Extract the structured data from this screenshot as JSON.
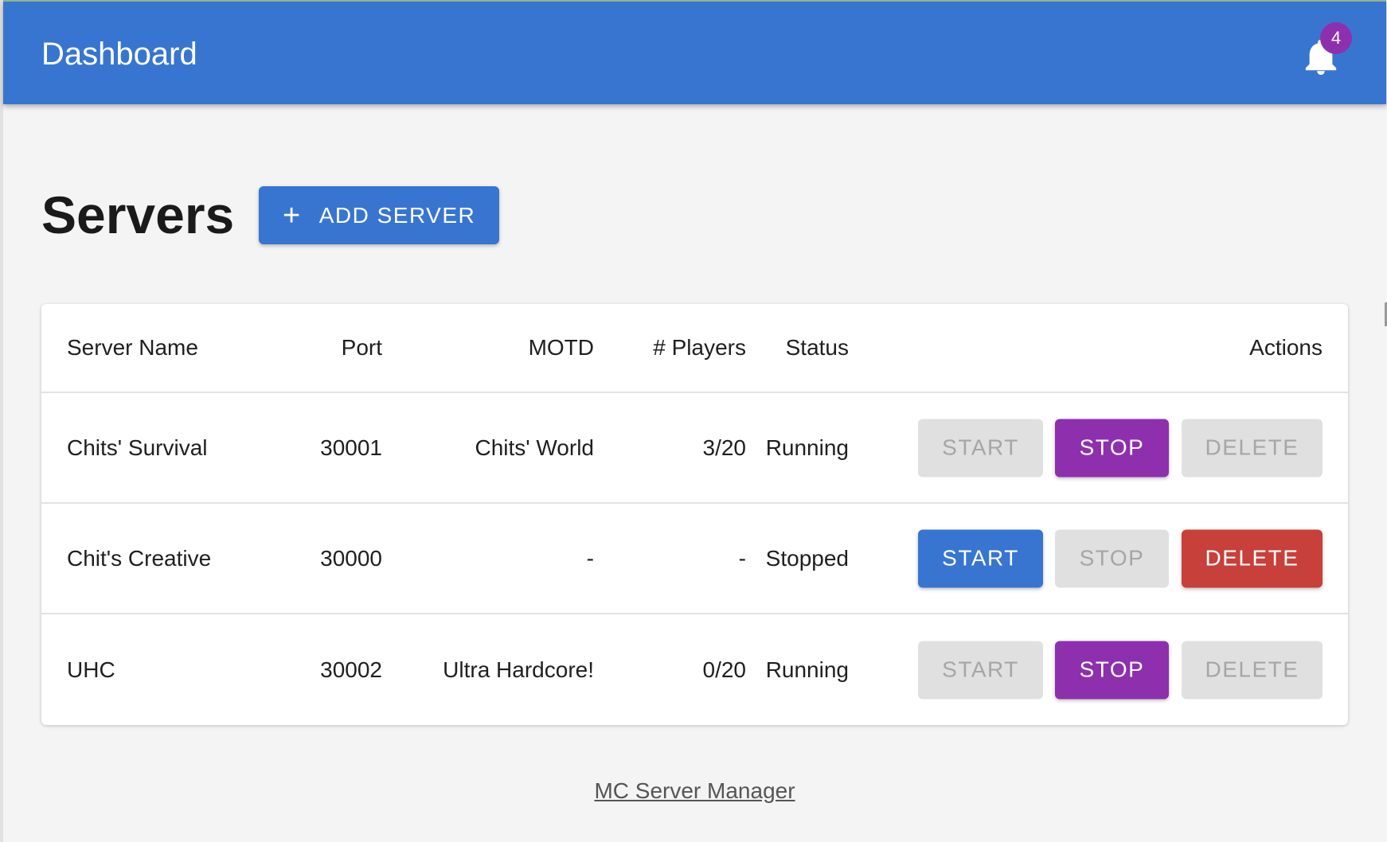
{
  "appbar": {
    "title": "Dashboard",
    "notifications": {
      "icon": "bell-icon",
      "count": "4"
    }
  },
  "page": {
    "title": "Servers",
    "add_button": {
      "icon": "plus-icon",
      "label": "ADD SERVER"
    }
  },
  "table": {
    "columns": {
      "name": "Server Name",
      "port": "Port",
      "motd": "MOTD",
      "players": "# Players",
      "status": "Status",
      "actions": "Actions"
    },
    "rows": [
      {
        "name": "Chits' Survival",
        "port": "30001",
        "motd": "Chits' World",
        "players": "3/20",
        "status": "Running",
        "start_label": "START",
        "stop_label": "STOP",
        "delete_label": "DELETE",
        "start_enabled": false,
        "stop_enabled": true,
        "delete_enabled": false
      },
      {
        "name": "Chit's Creative",
        "port": "30000",
        "motd": "-",
        "players": "-",
        "status": "Stopped",
        "start_label": "START",
        "stop_label": "STOP",
        "delete_label": "DELETE",
        "start_enabled": true,
        "stop_enabled": false,
        "delete_enabled": true
      },
      {
        "name": "UHC",
        "port": "30002",
        "motd": "Ultra Hardcore!",
        "players": "0/20",
        "status": "Running",
        "start_label": "START",
        "stop_label": "STOP",
        "delete_label": "DELETE",
        "start_enabled": false,
        "stop_enabled": true,
        "delete_enabled": false
      }
    ]
  },
  "footer": {
    "link_label": "MC Server Manager"
  },
  "colors": {
    "primary": "#3875d0",
    "secondary": "#8e2fae",
    "danger": "#c8403a",
    "disabled_bg": "#e0e0e0",
    "disabled_text": "#a6a6a6",
    "background": "#f4f4f4"
  }
}
